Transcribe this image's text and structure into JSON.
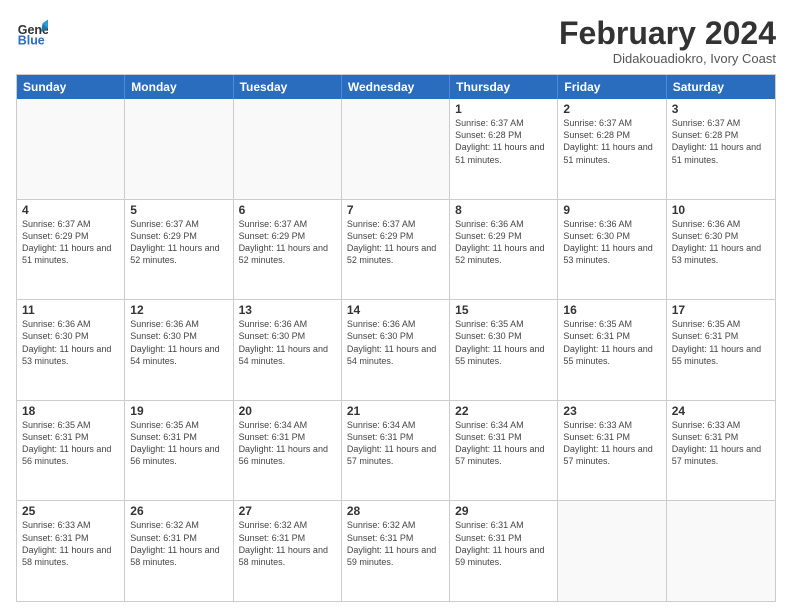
{
  "header": {
    "logo_general": "General",
    "logo_blue": "Blue",
    "month_title": "February 2024",
    "location": "Didakouadiokro, Ivory Coast"
  },
  "days_of_week": [
    "Sunday",
    "Monday",
    "Tuesday",
    "Wednesday",
    "Thursday",
    "Friday",
    "Saturday"
  ],
  "weeks": [
    [
      {
        "day": "",
        "info": ""
      },
      {
        "day": "",
        "info": ""
      },
      {
        "day": "",
        "info": ""
      },
      {
        "day": "",
        "info": ""
      },
      {
        "day": "1",
        "info": "Sunrise: 6:37 AM\nSunset: 6:28 PM\nDaylight: 11 hours and 51 minutes."
      },
      {
        "day": "2",
        "info": "Sunrise: 6:37 AM\nSunset: 6:28 PM\nDaylight: 11 hours and 51 minutes."
      },
      {
        "day": "3",
        "info": "Sunrise: 6:37 AM\nSunset: 6:28 PM\nDaylight: 11 hours and 51 minutes."
      }
    ],
    [
      {
        "day": "4",
        "info": "Sunrise: 6:37 AM\nSunset: 6:29 PM\nDaylight: 11 hours and 51 minutes."
      },
      {
        "day": "5",
        "info": "Sunrise: 6:37 AM\nSunset: 6:29 PM\nDaylight: 11 hours and 52 minutes."
      },
      {
        "day": "6",
        "info": "Sunrise: 6:37 AM\nSunset: 6:29 PM\nDaylight: 11 hours and 52 minutes."
      },
      {
        "day": "7",
        "info": "Sunrise: 6:37 AM\nSunset: 6:29 PM\nDaylight: 11 hours and 52 minutes."
      },
      {
        "day": "8",
        "info": "Sunrise: 6:36 AM\nSunset: 6:29 PM\nDaylight: 11 hours and 52 minutes."
      },
      {
        "day": "9",
        "info": "Sunrise: 6:36 AM\nSunset: 6:30 PM\nDaylight: 11 hours and 53 minutes."
      },
      {
        "day": "10",
        "info": "Sunrise: 6:36 AM\nSunset: 6:30 PM\nDaylight: 11 hours and 53 minutes."
      }
    ],
    [
      {
        "day": "11",
        "info": "Sunrise: 6:36 AM\nSunset: 6:30 PM\nDaylight: 11 hours and 53 minutes."
      },
      {
        "day": "12",
        "info": "Sunrise: 6:36 AM\nSunset: 6:30 PM\nDaylight: 11 hours and 54 minutes."
      },
      {
        "day": "13",
        "info": "Sunrise: 6:36 AM\nSunset: 6:30 PM\nDaylight: 11 hours and 54 minutes."
      },
      {
        "day": "14",
        "info": "Sunrise: 6:36 AM\nSunset: 6:30 PM\nDaylight: 11 hours and 54 minutes."
      },
      {
        "day": "15",
        "info": "Sunrise: 6:35 AM\nSunset: 6:30 PM\nDaylight: 11 hours and 55 minutes."
      },
      {
        "day": "16",
        "info": "Sunrise: 6:35 AM\nSunset: 6:31 PM\nDaylight: 11 hours and 55 minutes."
      },
      {
        "day": "17",
        "info": "Sunrise: 6:35 AM\nSunset: 6:31 PM\nDaylight: 11 hours and 55 minutes."
      }
    ],
    [
      {
        "day": "18",
        "info": "Sunrise: 6:35 AM\nSunset: 6:31 PM\nDaylight: 11 hours and 56 minutes."
      },
      {
        "day": "19",
        "info": "Sunrise: 6:35 AM\nSunset: 6:31 PM\nDaylight: 11 hours and 56 minutes."
      },
      {
        "day": "20",
        "info": "Sunrise: 6:34 AM\nSunset: 6:31 PM\nDaylight: 11 hours and 56 minutes."
      },
      {
        "day": "21",
        "info": "Sunrise: 6:34 AM\nSunset: 6:31 PM\nDaylight: 11 hours and 57 minutes."
      },
      {
        "day": "22",
        "info": "Sunrise: 6:34 AM\nSunset: 6:31 PM\nDaylight: 11 hours and 57 minutes."
      },
      {
        "day": "23",
        "info": "Sunrise: 6:33 AM\nSunset: 6:31 PM\nDaylight: 11 hours and 57 minutes."
      },
      {
        "day": "24",
        "info": "Sunrise: 6:33 AM\nSunset: 6:31 PM\nDaylight: 11 hours and 57 minutes."
      }
    ],
    [
      {
        "day": "25",
        "info": "Sunrise: 6:33 AM\nSunset: 6:31 PM\nDaylight: 11 hours and 58 minutes."
      },
      {
        "day": "26",
        "info": "Sunrise: 6:32 AM\nSunset: 6:31 PM\nDaylight: 11 hours and 58 minutes."
      },
      {
        "day": "27",
        "info": "Sunrise: 6:32 AM\nSunset: 6:31 PM\nDaylight: 11 hours and 58 minutes."
      },
      {
        "day": "28",
        "info": "Sunrise: 6:32 AM\nSunset: 6:31 PM\nDaylight: 11 hours and 59 minutes."
      },
      {
        "day": "29",
        "info": "Sunrise: 6:31 AM\nSunset: 6:31 PM\nDaylight: 11 hours and 59 minutes."
      },
      {
        "day": "",
        "info": ""
      },
      {
        "day": "",
        "info": ""
      }
    ]
  ]
}
